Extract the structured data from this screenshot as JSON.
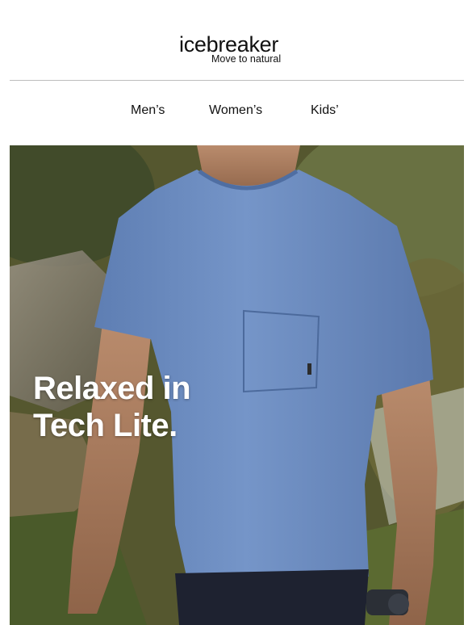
{
  "brand": {
    "name": "icebreaker",
    "tagline": "Move to natural"
  },
  "nav": {
    "items": [
      "Men’s",
      "Women’s",
      "Kids’"
    ]
  },
  "hero": {
    "title_line1": "Relaxed in",
    "title_line2": "Tech Lite.",
    "image_description_icon": "model-wearing-blue-tshirt-image",
    "colors": {
      "shirt": "#6f8fc2",
      "title": "#ffffff"
    }
  }
}
